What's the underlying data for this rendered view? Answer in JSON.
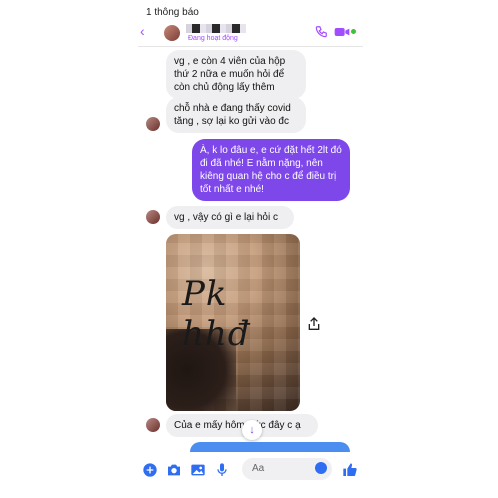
{
  "header": {
    "notification": "1 thông báo",
    "status": "Đang hoạt động"
  },
  "messages": [
    {
      "side": "in",
      "text": "vg , e còn 4 viên của hộp thứ 2 nữa e muốn hỏi để còn chủ động lấy thêm"
    },
    {
      "side": "in",
      "text": "chỗ nhà e đang thấy covid tăng , sợ lại ko gửi vào đc"
    },
    {
      "side": "out",
      "text": "À, k lo đâu e, e cứ đặt hết 2lt đó đi đã nhé! E nằm nặng, nên kiêng quan hệ cho c để điều trị tốt nhất e nhé!"
    },
    {
      "side": "in",
      "text": "vg , vậy có gì e lại hỏi c"
    },
    {
      "side": "in",
      "text": "Của e mấy hôm ước đây c ạ"
    }
  ],
  "photo": {
    "watermark": "Pk hhđ"
  },
  "composer": {
    "placeholder": "Aa"
  },
  "colors": {
    "accent": "#7e47ea",
    "brand_blue": "#2f6ef2"
  },
  "icons": [
    "back-icon",
    "call-icon",
    "video-icon",
    "share-icon",
    "scroll-down-icon",
    "plus-icon",
    "camera-icon",
    "image-icon",
    "mic-icon",
    "emoji-icon",
    "like-icon"
  ]
}
